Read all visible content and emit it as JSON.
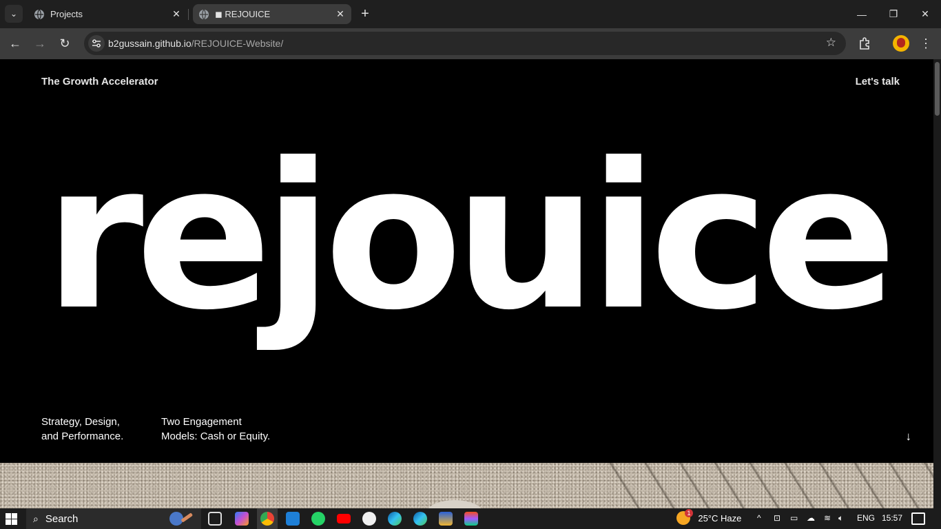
{
  "browser": {
    "tabs": [
      {
        "title": "Projects",
        "active": false
      },
      {
        "title": "REJOUICE",
        "active": true
      }
    ],
    "url_host": "b2gussain.github.io",
    "url_path": "/REJOUICE-Website/"
  },
  "page": {
    "nav_left": "The Growth Accelerator",
    "nav_right": "Let's talk",
    "hero_word": "rejouice",
    "copy_1_line_1": "Strategy, Design,",
    "copy_1_line_2": "and Performance.",
    "copy_2_line_1": "Two Engagement",
    "copy_2_line_2": "Models: Cash or Equity.",
    "scroll_arrow": "↓"
  },
  "taskbar": {
    "search_label": "Search",
    "weather": "25°C  Haze",
    "weather_alert": "1",
    "language": "ENG",
    "time": "15:57"
  },
  "colors": {
    "page_bg": "#000000",
    "hero_text": "#ffffff",
    "chrome_dark": "#1f1f1f",
    "chrome_toolbar": "#3c3c3c"
  }
}
